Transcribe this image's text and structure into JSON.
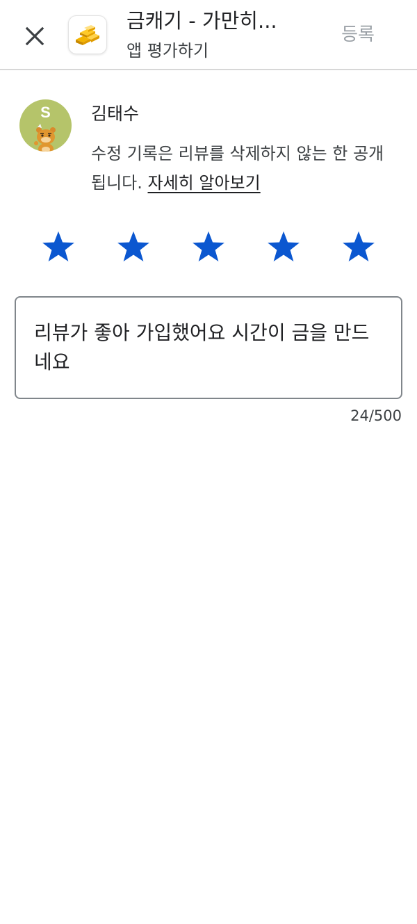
{
  "header": {
    "app_title": "금캐기 - 가만히...",
    "subtitle": "앱 평가하기",
    "submit_label": "등록",
    "close_icon": "close-icon",
    "app_icon": "gold-bars-icon"
  },
  "user": {
    "avatar_letter": "S",
    "avatar_color": "#b5c46a",
    "name": "김태수"
  },
  "notice": {
    "text": "수정 기록은 리뷰를 삭제하지 않는 한 공개됩니다. ",
    "link_label": "자세히 알아보기"
  },
  "rating": {
    "value": 5,
    "max": 5,
    "star_color": "#0b57d0"
  },
  "review": {
    "text": "리뷰가 좋아 가입했어요 시간이 금을 만드네요",
    "char_count": "24/500"
  },
  "colors": {
    "divider": "#d7d7d7",
    "muted_text": "#9aa0a6",
    "field_border": "#80868b"
  }
}
